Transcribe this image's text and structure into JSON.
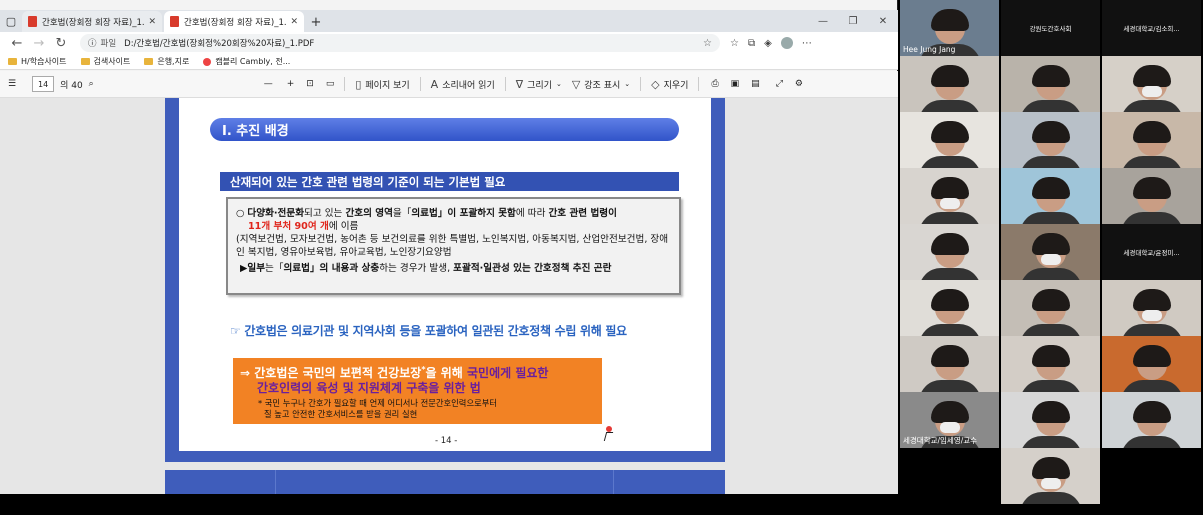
{
  "browser": {
    "tabs": [
      {
        "title": "간호법(장회정 회장 자료)_1.PDF",
        "active": false
      },
      {
        "title": "간호법(장회정 회장 자료)_1.PDF",
        "active": true
      }
    ],
    "address": {
      "label": "파일",
      "url": "D:/간호법/간호법(장회정%20회장%20자료)_1.PDF"
    },
    "bookmarks": [
      "H/학습사이트",
      "검색사이트",
      "은행,지로",
      "캠블리 Cambly, 전..."
    ]
  },
  "pdf_toolbar": {
    "page": "14",
    "total": "의 40",
    "page_view": "페이지 보기",
    "read_aloud": "소리내어 읽기",
    "draw": "그리기",
    "highlight": "강조 표시",
    "erase": "지우기"
  },
  "slide": {
    "section": "Ⅰ. 추진 배경",
    "subheader": "산재되어 있는 간호 관련 법령의 기준이 되는 기본법 필요",
    "box": {
      "l1a": "○ ",
      "l1b": "다양화·전문화",
      "l1c": "되고 있는 ",
      "l1d": "간호의 영역",
      "l1e": "을「",
      "l1f": "의료법",
      "l1g": "」이 포괄하지 못함",
      "l1h": "에 따라 ",
      "l1i": "간호 관련 법령이",
      "l2a": "11개 부처 90여 개",
      "l2b": "에 이름",
      "l3": "(지역보건법, 모자보건법, 농어촌 등 보건의료를 위한 특별법, 노인복지법, 아동복지법, 산업안전보건법, 장애인 복지법, 영유아보육법, 유아교육법, 노인장기요양법",
      "l4a": "▶",
      "l4b": "일부",
      "l4c": "는「",
      "l4d": "의료법",
      "l4e": "」의 내용과 상충",
      "l4f": "하는 경우가 발생, ",
      "l4g": "포괄적·일관성 있는 간호정책 추진 곤란"
    },
    "note": "☞ 간호법은 의료기관 및 지역사회 등을 포괄하여 일관된 간호정책 수립 위해 필요",
    "orange": {
      "a": "⇒ 간호법은 국민의 보편적 건강보장",
      "b": "*",
      "c": "을 위해 ",
      "d": "국민에게 필요한",
      "e": "간호인력의 육성 및 지원체계 구축을 위한 법",
      "f": "* 국민 누구나 간호가 필요할 때 언제 어디서나 전문간호인력으로부터",
      "g": "질 높고 안전한 간호서비스를 받을 권리 실현"
    },
    "page_number": "- 14 -"
  },
  "participants": [
    {
      "name": "Hee Jung Jang",
      "center": "",
      "style": "photo",
      "bg": "#6b7d8f"
    },
    {
      "name": "강원도간호사회",
      "center": "강원도간호사회",
      "style": "blank",
      "bg": "#111111"
    },
    {
      "name": "",
      "center": "세경대학교/김소희...",
      "style": "blank",
      "bg": "#111111"
    },
    {
      "name": "",
      "center": "",
      "style": "photo",
      "bg": "#c9c4bd"
    },
    {
      "name": "",
      "center": "",
      "style": "photo",
      "bg": "#b9b3aa"
    },
    {
      "name": "",
      "center": "",
      "style": "photo",
      "bg": "#d6d0c8"
    },
    {
      "name": "",
      "center": "",
      "style": "photo",
      "bg": "#e7e4df"
    },
    {
      "name": "",
      "center": "",
      "style": "photo",
      "bg": "#b8c0c8"
    },
    {
      "name": "",
      "center": "",
      "style": "photo",
      "bg": "#c8b8a8"
    },
    {
      "name": "",
      "center": "",
      "style": "photo",
      "bg": "#d8d4cf"
    },
    {
      "name": "",
      "center": "",
      "style": "photo",
      "bg": "#9fc5d9"
    },
    {
      "name": "",
      "center": "",
      "style": "photo",
      "bg": "#a8a39c"
    },
    {
      "name": "",
      "center": "",
      "style": "photo",
      "bg": "#d9d6d2"
    },
    {
      "name": "",
      "center": "",
      "style": "photo",
      "bg": "#8b7a6a"
    },
    {
      "name": "",
      "center": "세경대학교/윤정미...",
      "style": "blank",
      "bg": "#111111"
    },
    {
      "name": "",
      "center": "",
      "style": "photo",
      "bg": "#e0ddd8"
    },
    {
      "name": "",
      "center": "",
      "style": "photo",
      "bg": "#c4beb6"
    },
    {
      "name": "",
      "center": "",
      "style": "photo",
      "bg": "#d0cac2"
    },
    {
      "name": "",
      "center": "",
      "style": "photo",
      "bg": "#cfcac4"
    },
    {
      "name": "",
      "center": "",
      "style": "photo",
      "bg": "#d3cdc6"
    },
    {
      "name": "",
      "center": "",
      "style": "photo",
      "bg": "#c96a2e"
    },
    {
      "name": "세경대학교/임세영/교수",
      "center": "",
      "style": "photo",
      "bg": "#8a8a8a"
    },
    {
      "name": "",
      "center": "",
      "style": "photo",
      "bg": "#d8d8d8"
    },
    {
      "name": "",
      "center": "",
      "style": "photo",
      "bg": "#cfd3d6"
    },
    {
      "name": "",
      "center": "",
      "style": "empty",
      "bg": "#000000"
    },
    {
      "name": "",
      "center": "",
      "style": "photo",
      "bg": "#d5d0ca"
    },
    {
      "name": "",
      "center": "",
      "style": "empty",
      "bg": "#000000"
    }
  ]
}
